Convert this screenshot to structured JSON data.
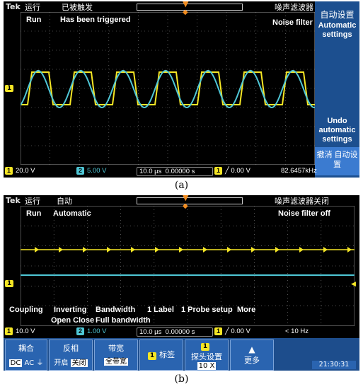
{
  "panel_a": {
    "brand": "Tek",
    "run_cn": "运行",
    "trigger_cn": "已被触发",
    "right_cn": "噪声滤波器",
    "run_en": "Run",
    "trigger_en": "Has been triggered",
    "filter_en": "Noise filter",
    "side_title_cn": "自动设置",
    "side_title_en": "Automatic settings",
    "side_undo_en": "Undo automatic settings",
    "side_undo_cn": "撤消 自动设置",
    "ch_marker": "1",
    "status": {
      "ch1_num": "1",
      "ch1": "20.0 V",
      "ch2_num": "2",
      "ch2": "5.00 V",
      "timebase": "10.0 µs",
      "position": "0.00000 s",
      "trig_num": "1",
      "trig_level": "0.00 V",
      "freq": "82.6457kHz"
    },
    "caption": "(a)"
  },
  "panel_b": {
    "brand": "Tek",
    "run_cn": "运行",
    "mode_cn": "自动",
    "right_cn": "噪声滤波器关闭",
    "run_en": "Run",
    "mode_en": "Automatic",
    "filter_en": "Noise filter off",
    "ch_marker": "1",
    "labels_en": {
      "coupling": "Coupling",
      "inverting": "Inverting",
      "bandwidth": "Bandwidth",
      "label": "1 Label",
      "probe": "1 Probe setup",
      "more": "More",
      "open_close": "Open Close",
      "full_bw": "Full bandwidth"
    },
    "status": {
      "ch1_num": "1",
      "ch1": "10.0 V",
      "ch2_num": "2",
      "ch2": "1.00 V",
      "timebase": "10.0 µs",
      "position": "0.00000 s",
      "trig_num": "1",
      "trig_level": "0.00 V",
      "freq": "< 10 Hz"
    },
    "menu": {
      "coupling_cn": "耦合",
      "coupling_opts": [
        "DC",
        "AC",
        "⏚"
      ],
      "invert_cn": "反相",
      "invert_opts": [
        "开启",
        "关闭"
      ],
      "bw_cn": "带宽",
      "bw_val": "全带宽",
      "label_num": "1",
      "label_cn": "标签",
      "probe_num": "1",
      "probe_cn": "探头设置",
      "probe_val": "10 X",
      "more_cn": "更多",
      "clock": "21:30:31"
    },
    "caption": "(b)"
  },
  "colors": {
    "ch1": "#f5e625",
    "ch2": "#4fc7d6",
    "trigger": "#f28c1f",
    "menu_bg": "#1d4d8c"
  }
}
